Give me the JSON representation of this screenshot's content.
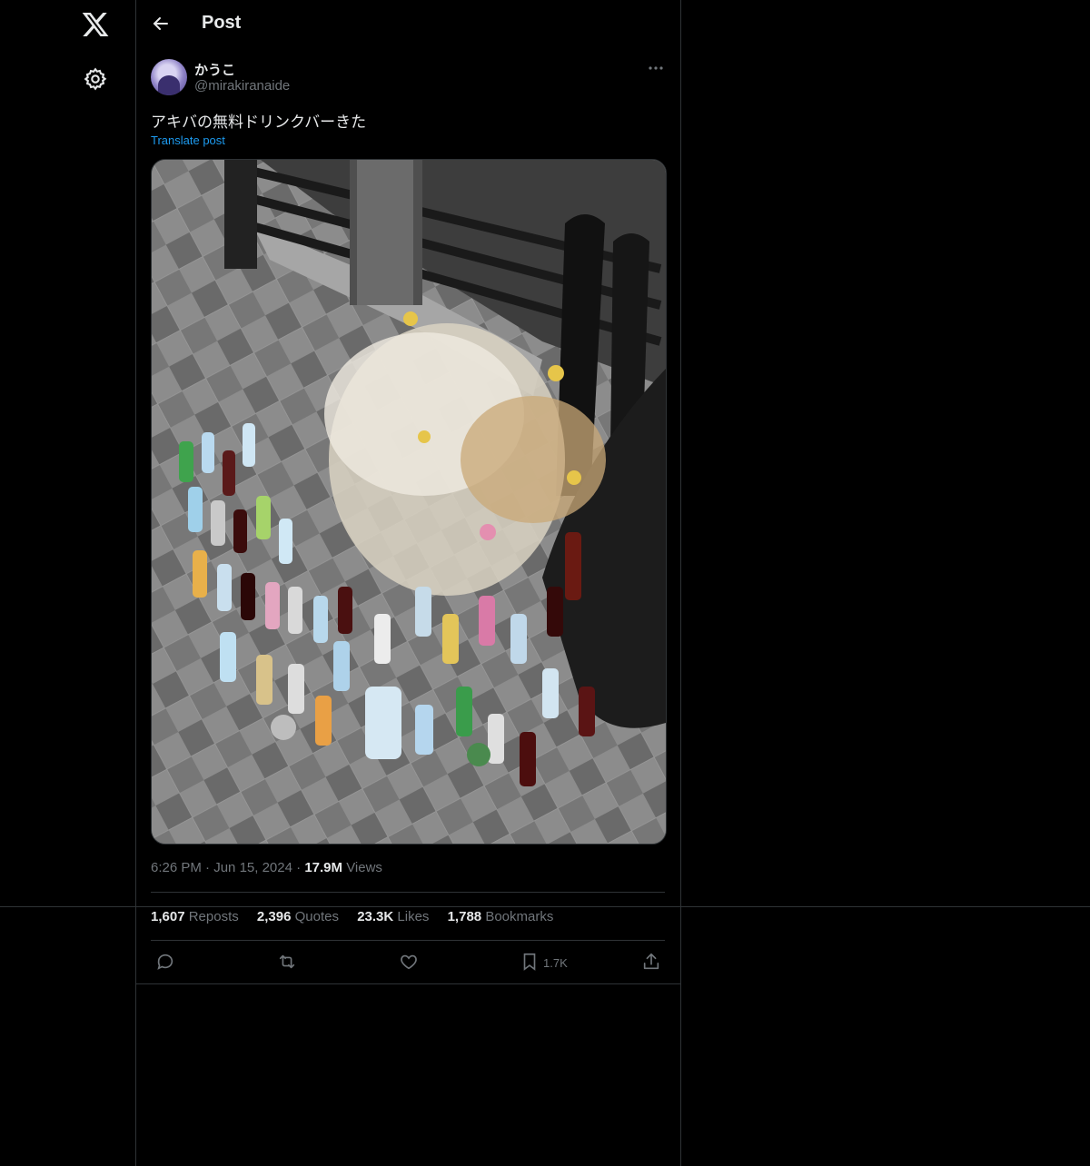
{
  "header": {
    "title": "Post"
  },
  "post": {
    "display_name": "かうこ",
    "handle": "@mirakiranaide",
    "text": "アキバの無料ドリンクバーきた",
    "translate_label": "Translate post",
    "time": "6:26 PM",
    "date": "Jun 15, 2024",
    "views_count": "17.9M",
    "views_label": "Views",
    "image_alt": "Memorial of flowers and drink bottles on a sidewalk"
  },
  "stats": {
    "reposts_count": "1,607",
    "reposts_label": "Reposts",
    "quotes_count": "2,396",
    "quotes_label": "Quotes",
    "likes_count": "23.3K",
    "likes_label": "Likes",
    "bookmarks_count": "1,788",
    "bookmarks_label": "Bookmarks"
  },
  "actions": {
    "bookmark_count": "1.7K"
  },
  "colors": {
    "background": "#000000",
    "border": "#2f3336",
    "text": "#e7e9ea",
    "muted": "#71767b",
    "accent": "#1d9bf0"
  },
  "icons": [
    "x-logo-icon",
    "gear-icon",
    "back-arrow-icon",
    "more-icon",
    "reply-icon",
    "repost-icon",
    "like-icon",
    "bookmark-icon",
    "share-icon"
  ]
}
